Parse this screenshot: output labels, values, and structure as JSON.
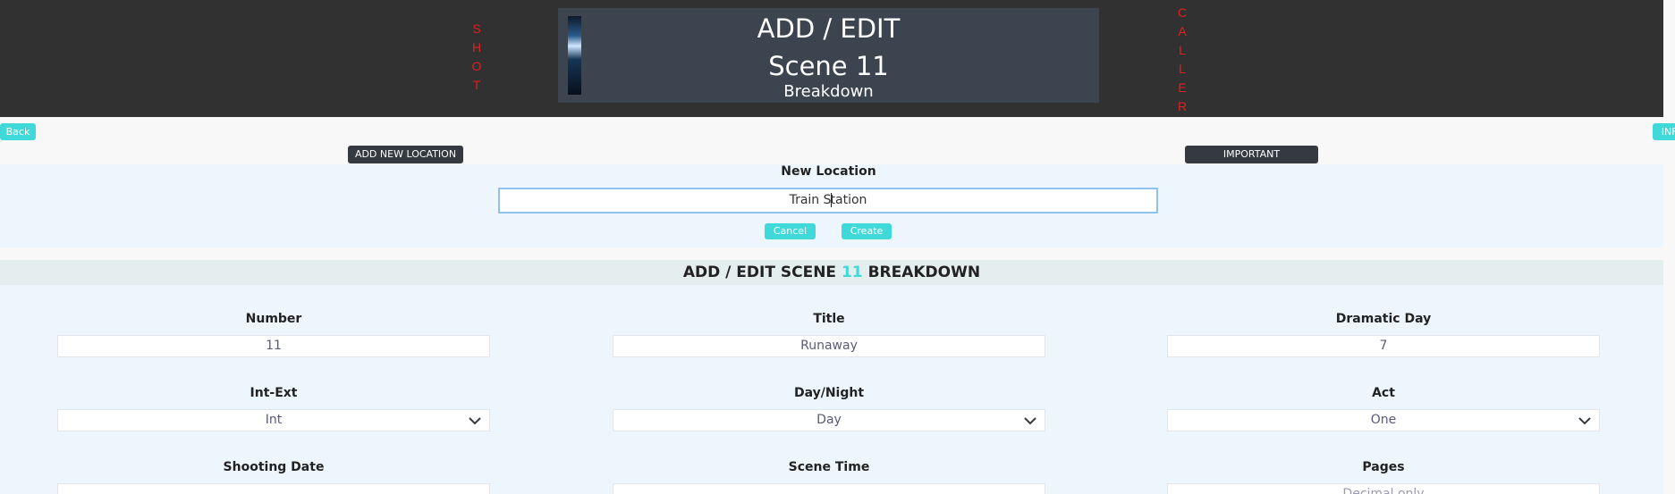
{
  "header": {
    "shot_letters": [
      "S",
      "H",
      "O",
      "T"
    ],
    "caller_letters": [
      "C",
      "A",
      "L",
      "L",
      "E",
      "R"
    ],
    "title_line1": "ADD / EDIT",
    "title_line2": "Scene 11",
    "title_line3": "Breakdown"
  },
  "nav": {
    "back_label": "Back",
    "info_label": "INFO",
    "add_location_label": "ADD NEW LOCATION",
    "important_label": "IMPORTANT"
  },
  "new_location": {
    "label": "New Location",
    "value_before_caret": "Train S",
    "value_after_caret": "tation",
    "cancel_label": "Cancel",
    "create_label": "Create"
  },
  "section": {
    "prefix": "ADD / EDIT SCENE",
    "scene_number": "11",
    "suffix": "BREAKDOWN"
  },
  "form": {
    "number": {
      "label": "Number",
      "value": "11"
    },
    "title": {
      "label": "Title",
      "value": "Runaway"
    },
    "dramatic_day": {
      "label": "Dramatic Day",
      "value": "7"
    },
    "int_ext": {
      "label": "Int-Ext",
      "value": "Int"
    },
    "day_night": {
      "label": "Day/Night",
      "value": "Day"
    },
    "act": {
      "label": "Act",
      "value": "One"
    },
    "shooting_date": {
      "label": "Shooting Date",
      "value": ""
    },
    "scene_time": {
      "label": "Scene Time",
      "value": ""
    },
    "pages": {
      "label": "Pages",
      "placeholder": "Decimal only"
    }
  },
  "colors": {
    "accent": "#3fd9d9",
    "header_bg": "#313131",
    "vertical_text": "#e02020",
    "dark_button": "#343a40"
  }
}
